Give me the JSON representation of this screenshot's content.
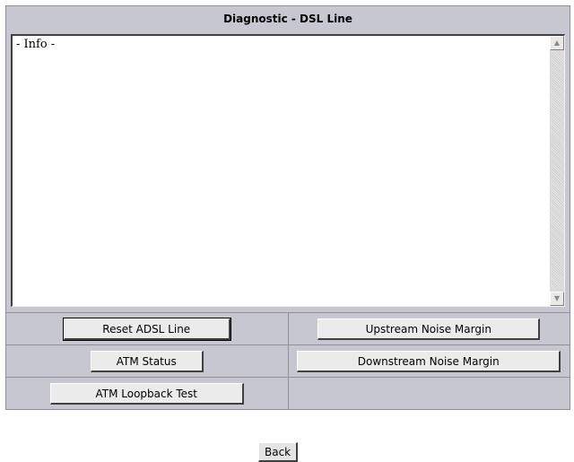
{
  "title": "Diagnostic - DSL Line",
  "info": {
    "text": "- Info -"
  },
  "buttons": {
    "reset_adsl_line": "Reset ADSL Line",
    "upstream_noise_margin": "Upstream Noise Margin",
    "atm_status": "ATM Status",
    "downstream_noise_margin": "Downstream Noise Margin",
    "atm_loopback_test": "ATM Loopback Test",
    "back": "Back"
  },
  "icons": {
    "scroll_up": "scroll-up-arrow-icon",
    "scroll_down": "scroll-down-arrow-icon"
  },
  "colors": {
    "panel_bg": "#c7c7d1",
    "button_bg": "#ebebeb"
  }
}
